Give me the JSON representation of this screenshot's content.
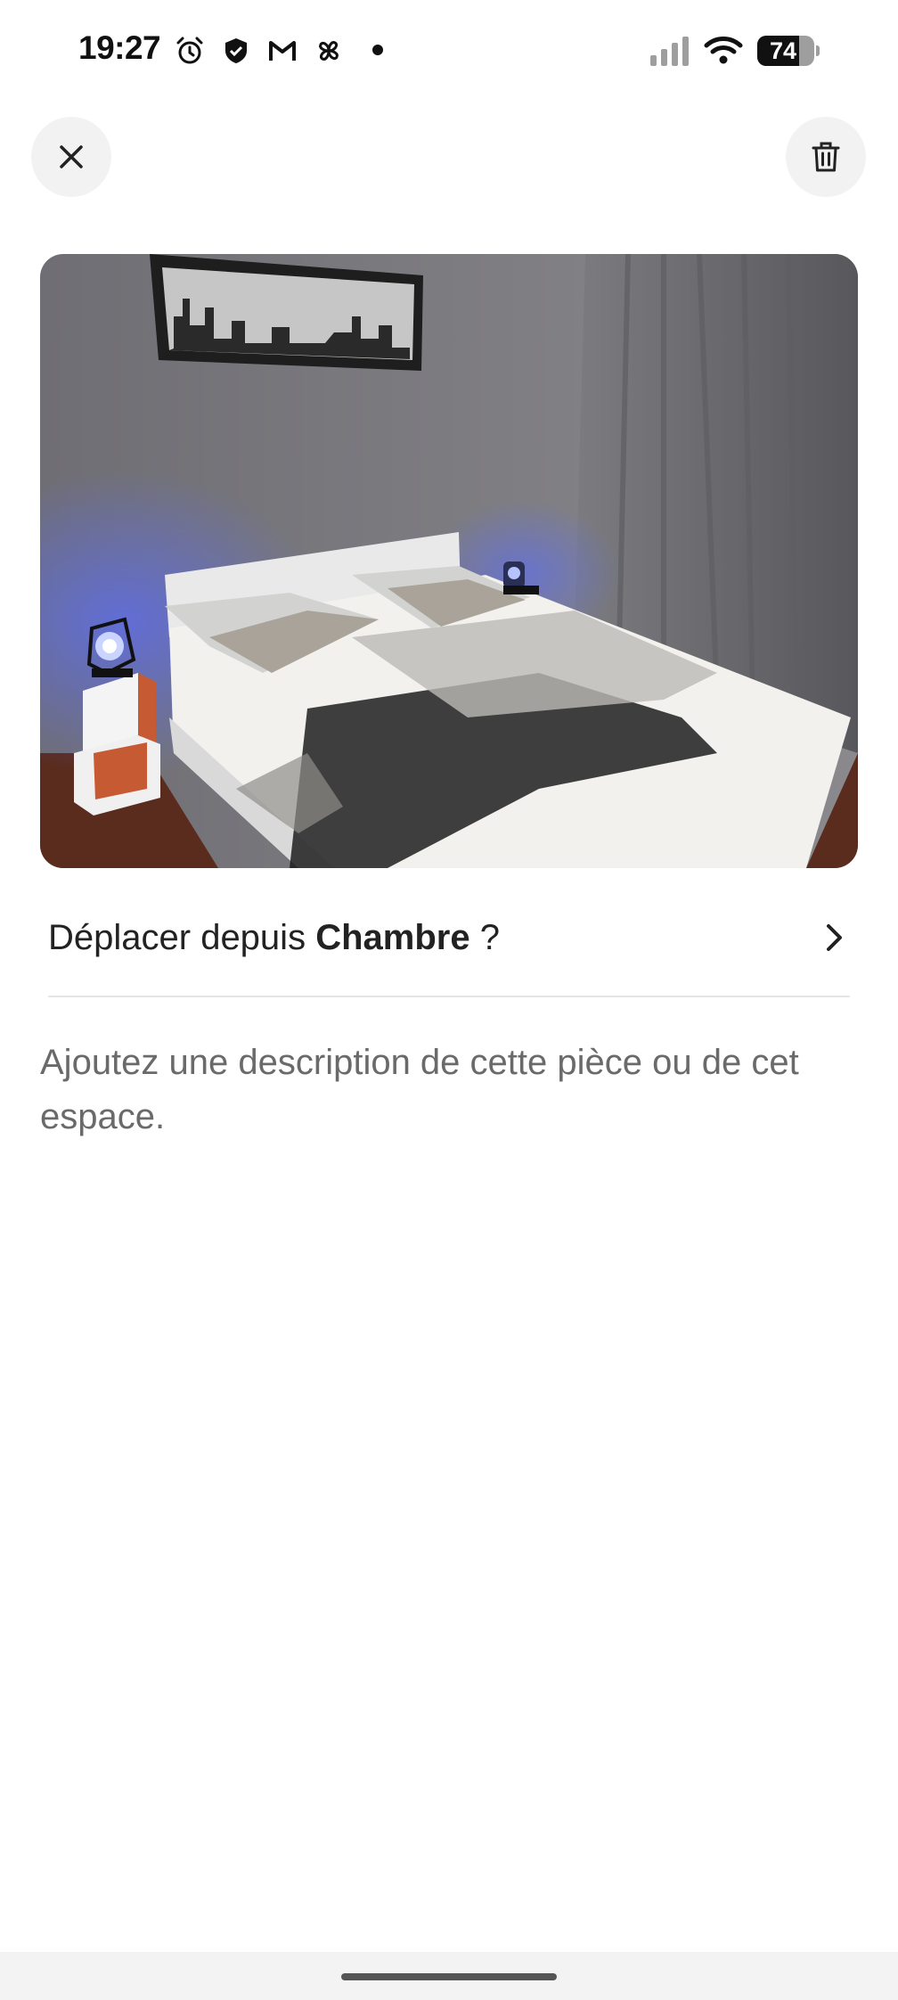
{
  "status_bar": {
    "time": "19:27",
    "icons": [
      "alarm-icon",
      "shield-icon",
      "gmail-icon",
      "pinwheel-icon",
      "notification-dot"
    ],
    "battery_percent": 74,
    "battery_label": "74"
  },
  "header": {
    "close_icon": "close-icon",
    "delete_icon": "trash-icon"
  },
  "photo": {
    "subject": "bedroom"
  },
  "move": {
    "prefix": "Déplacer depuis ",
    "room": "Chambre",
    "suffix": " ?"
  },
  "description": {
    "placeholder": "Ajoutez une description de cette pièce ou de cet espace."
  },
  "colors": {
    "text_primary": "#222222",
    "text_secondary": "#6a6a6a",
    "button_bg": "#f2f2f2",
    "divider": "#e5e5e5"
  }
}
